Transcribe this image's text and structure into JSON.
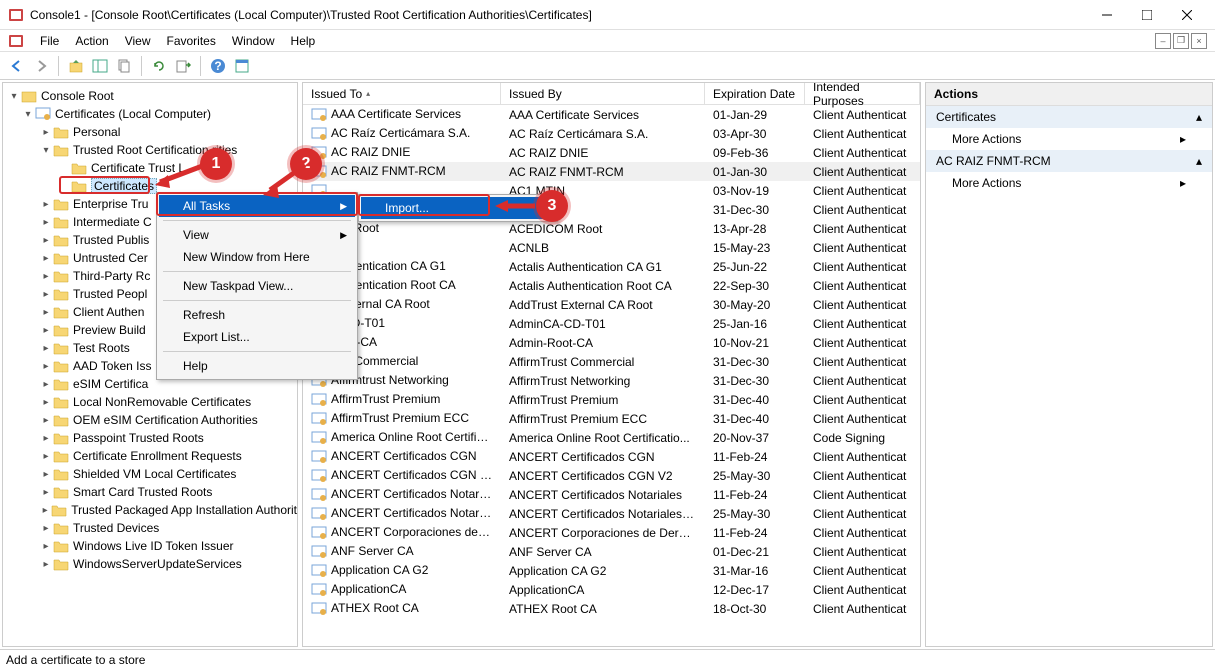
{
  "window": {
    "title": "Console1 - [Console Root\\Certificates (Local Computer)\\Trusted Root Certification Authorities\\Certificates]"
  },
  "menubar": {
    "items": [
      "File",
      "Action",
      "View",
      "Favorites",
      "Window",
      "Help"
    ]
  },
  "tree": {
    "root": "Console Root",
    "cert_root": "Certificates (Local Computer)",
    "nodes": [
      {
        "label": "Personal",
        "exp": false,
        "indent": 2
      },
      {
        "label": "Trusted Root Certification Authorities",
        "exp": true,
        "indent": 2,
        "truncated": "Trusted Root Certification        rities"
      },
      {
        "label": "Certificate Trust L",
        "exp": null,
        "indent": 3
      },
      {
        "label": "Certificates",
        "exp": null,
        "indent": 3,
        "selected": true
      },
      {
        "label": "Enterprise Tru",
        "exp": false,
        "indent": 2
      },
      {
        "label": "Intermediate C",
        "exp": false,
        "indent": 2
      },
      {
        "label": "Trusted Publis",
        "exp": false,
        "indent": 2
      },
      {
        "label": "Untrusted Cer",
        "exp": false,
        "indent": 2
      },
      {
        "label": "Third-Party Rc",
        "exp": false,
        "indent": 2
      },
      {
        "label": "Trusted Peopl",
        "exp": false,
        "indent": 2
      },
      {
        "label": "Client Authen",
        "exp": false,
        "indent": 2
      },
      {
        "label": "Preview Build",
        "exp": false,
        "indent": 2
      },
      {
        "label": "Test Roots",
        "exp": false,
        "indent": 2
      },
      {
        "label": "AAD Token Iss",
        "exp": false,
        "indent": 2
      },
      {
        "label": "eSIM Certifica",
        "exp": false,
        "indent": 2
      },
      {
        "label": "Local NonRemovable Certificates",
        "exp": false,
        "indent": 2
      },
      {
        "label": "OEM eSIM Certification Authorities",
        "exp": false,
        "indent": 2
      },
      {
        "label": "Passpoint Trusted Roots",
        "exp": false,
        "indent": 2
      },
      {
        "label": "Certificate Enrollment Requests",
        "exp": false,
        "indent": 2
      },
      {
        "label": "Shielded VM Local Certificates",
        "exp": false,
        "indent": 2
      },
      {
        "label": "Smart Card Trusted Roots",
        "exp": false,
        "indent": 2
      },
      {
        "label": "Trusted Packaged App Installation Authorit",
        "exp": false,
        "indent": 2
      },
      {
        "label": "Trusted Devices",
        "exp": false,
        "indent": 2
      },
      {
        "label": "Windows Live ID Token Issuer",
        "exp": false,
        "indent": 2
      },
      {
        "label": "WindowsServerUpdateServices",
        "exp": false,
        "indent": 2
      }
    ]
  },
  "list": {
    "columns": {
      "issued_to": "Issued To",
      "issued_by": "Issued By",
      "expiration": "Expiration Date",
      "purposes": "Intended Purposes"
    },
    "rows": [
      {
        "to": "AAA Certificate Services",
        "by": "AAA Certificate Services",
        "exp": "01-Jan-29",
        "purp": "Client Authenticat"
      },
      {
        "to": "AC Raíz Certicámara S.A.",
        "by": "AC Raíz Certicámara S.A.",
        "exp": "03-Apr-30",
        "purp": "Client Authenticat"
      },
      {
        "to": "AC RAIZ DNIE",
        "by": "AC RAIZ DNIE",
        "exp": "09-Feb-36",
        "purp": "Client Authenticat"
      },
      {
        "to": "AC RAIZ FNMT-RCM",
        "by": "AC RAIZ FNMT-RCM",
        "exp": "01-Jan-30",
        "purp": "Client Authenticat",
        "selected": true
      },
      {
        "to": "",
        "by": "AC1           MTIN",
        "exp": "03-Nov-19",
        "purp": "Client Authenticat"
      },
      {
        "to": "",
        "by": "AC",
        "exp": "31-Dec-30",
        "purp": "Client Authenticat"
      },
      {
        "to": "OM Root",
        "by": "ACEDICOM Root",
        "exp": "13-Apr-28",
        "purp": "Client Authenticat"
      },
      {
        "to": "",
        "by": "ACNLB",
        "exp": "15-May-23",
        "purp": "Client Authenticat"
      },
      {
        "to": "Authentication CA G1",
        "by": "Actalis Authentication CA G1",
        "exp": "25-Jun-22",
        "purp": "Client Authenticat"
      },
      {
        "to": "Authentication Root CA",
        "by": "Actalis Authentication Root CA",
        "exp": "22-Sep-30",
        "purp": "Client Authenticat"
      },
      {
        "to": "t External CA Root",
        "by": "AddTrust External CA Root",
        "exp": "30-May-20",
        "purp": "Client Authenticat"
      },
      {
        "to": "A-CD-T01",
        "by": "AdminCA-CD-T01",
        "exp": "25-Jan-16",
        "purp": "Client Authenticat"
      },
      {
        "to": "Root-CA",
        "by": "Admin-Root-CA",
        "exp": "10-Nov-21",
        "purp": "Client Authenticat"
      },
      {
        "to": "rust Commercial",
        "by": "AffirmTrust Commercial",
        "exp": "31-Dec-30",
        "purp": "Client Authenticat"
      },
      {
        "to": "Affirmtrust Networking",
        "by": "AffirmTrust Networking",
        "exp": "31-Dec-30",
        "purp": "Client Authenticat"
      },
      {
        "to": "AffirmTrust Premium",
        "by": "AffirmTrust Premium",
        "exp": "31-Dec-40",
        "purp": "Client Authenticat"
      },
      {
        "to": "AffirmTrust Premium ECC",
        "by": "AffirmTrust Premium ECC",
        "exp": "31-Dec-40",
        "purp": "Client Authenticat"
      },
      {
        "to": "America Online Root Certificati...",
        "by": "America Online Root Certificatio...",
        "exp": "20-Nov-37",
        "purp": "Code Signing"
      },
      {
        "to": "ANCERT Certificados CGN",
        "by": "ANCERT Certificados CGN",
        "exp": "11-Feb-24",
        "purp": "Client Authenticat"
      },
      {
        "to": "ANCERT Certificados CGN V2",
        "by": "ANCERT Certificados CGN V2",
        "exp": "25-May-30",
        "purp": "Client Authenticat"
      },
      {
        "to": "ANCERT Certificados Notariales",
        "by": "ANCERT Certificados Notariales",
        "exp": "11-Feb-24",
        "purp": "Client Authenticat"
      },
      {
        "to": "ANCERT Certificados Notariale...",
        "by": "ANCERT Certificados Notariales V2",
        "exp": "25-May-30",
        "purp": "Client Authenticat"
      },
      {
        "to": "ANCERT Corporaciones de Dere...",
        "by": "ANCERT Corporaciones de Derech...",
        "exp": "11-Feb-24",
        "purp": "Client Authenticat"
      },
      {
        "to": "ANF Server CA",
        "by": "ANF Server CA",
        "exp": "01-Dec-21",
        "purp": "Client Authenticat"
      },
      {
        "to": "Application CA G2",
        "by": "Application CA G2",
        "exp": "31-Mar-16",
        "purp": "Client Authenticat"
      },
      {
        "to": "ApplicationCA",
        "by": "ApplicationCA",
        "exp": "12-Dec-17",
        "purp": "Client Authenticat"
      },
      {
        "to": "ATHEX Root CA",
        "by": "ATHEX Root CA",
        "exp": "18-Oct-30",
        "purp": "Client Authenticat"
      }
    ]
  },
  "actions": {
    "header": "Actions",
    "sections": [
      {
        "title": "Certificates",
        "link": "More Actions"
      },
      {
        "title": "AC RAIZ FNMT-RCM",
        "link": "More Actions"
      }
    ]
  },
  "context_menu": {
    "items": [
      {
        "label": "All Tasks",
        "arrow": true,
        "highlight": true
      },
      {
        "sep": true
      },
      {
        "label": "View",
        "arrow": true
      },
      {
        "label": "New Window from Here"
      },
      {
        "sep": true
      },
      {
        "label": "New Taskpad View..."
      },
      {
        "sep": true
      },
      {
        "label": "Refresh"
      },
      {
        "label": "Export List..."
      },
      {
        "sep": true
      },
      {
        "label": "Help"
      }
    ],
    "submenu": {
      "label": "Import...",
      "highlight": true
    }
  },
  "status": "Add a certificate to a store",
  "markers": {
    "m1": "1",
    "m2": "2",
    "m3": "3"
  }
}
